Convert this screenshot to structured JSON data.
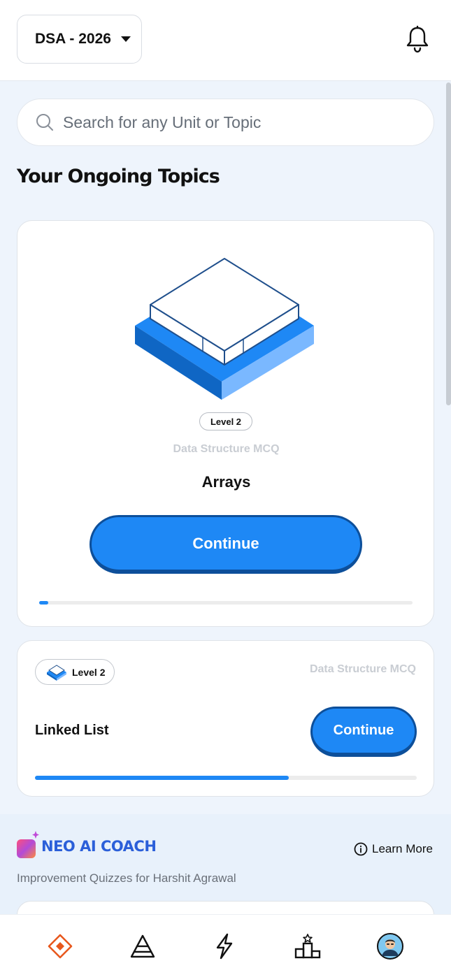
{
  "header": {
    "course_label": "DSA - 2026"
  },
  "search": {
    "placeholder": "Search for any Unit or Topic"
  },
  "ongoing": {
    "title": "Your Ongoing Topics",
    "main_card": {
      "level": "Level 2",
      "subject": "Data Structure MCQ",
      "topic": "Arrays",
      "button_label": "Continue",
      "progress_percent": 2.5
    },
    "second_card": {
      "level": "Level 2",
      "subject": "Data Structure MCQ",
      "topic": "Linked List",
      "button_label": "Continue",
      "progress_percent": 66.5
    }
  },
  "coach": {
    "title": "NEO AI COACH",
    "learn_more": "Learn More",
    "subtitle": "Improvement Quizzes for Harshit Agrawal"
  },
  "nav": {
    "items": [
      "home-icon",
      "pyramid-icon",
      "lightning-icon",
      "leaderboard-icon",
      "profile-avatar"
    ],
    "accent": "#e8581d"
  },
  "colors": {
    "primary": "#1e88f5",
    "primary_dark": "#0d4f9a",
    "background": "#eef4fc"
  }
}
